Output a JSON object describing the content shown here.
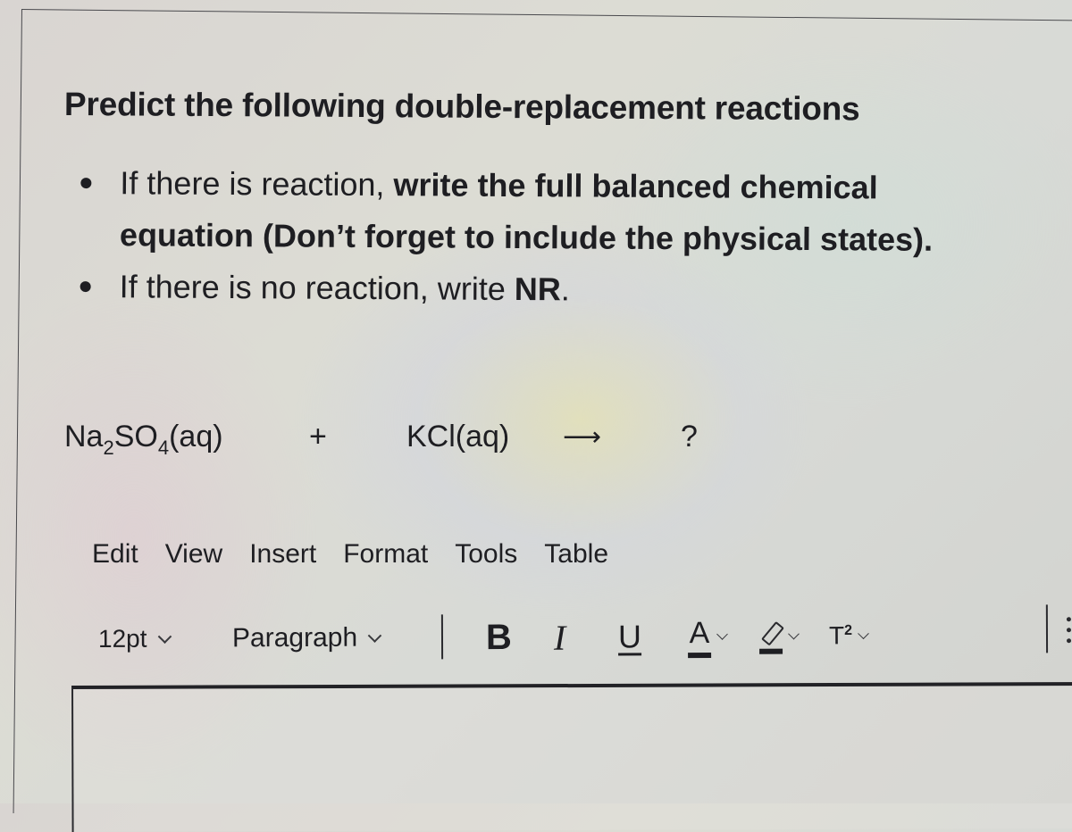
{
  "question": {
    "title": "Predict the following double-replacement reactions",
    "instructions": [
      {
        "normal": "If there is reaction, ",
        "bold": "write the full balanced chemical equation  (Don’t forget to include the physical states).",
        "line1_bold": "write the full balanced chemical",
        "line2_bold": "equation  (Don’t forget to include the physical states)."
      },
      {
        "normal": "If there is no reaction, write ",
        "bold": "NR",
        "trailing": "."
      }
    ]
  },
  "equation": {
    "reactant_1": {
      "prefix": "Na",
      "sub_1": "2",
      "middle": "SO",
      "sub_2": "4",
      "suffix": "(aq)"
    },
    "plus": "+",
    "reactant_2": "KCl(aq)",
    "arrow": "⟶",
    "product": "?"
  },
  "editor": {
    "menu": [
      "Edit",
      "View",
      "Insert",
      "Format",
      "Tools",
      "Table"
    ],
    "toolbar": {
      "font_size": "12pt",
      "block_format": "Paragraph",
      "bold": "B",
      "italic": "I",
      "underline": "U",
      "font_color": "A",
      "superscript_base": "T",
      "superscript_exp": "2"
    },
    "icons": {
      "font_color": "font-color-icon",
      "highlight": "highlight-pen-icon",
      "superscript": "superscript-icon",
      "more": "more-vertical-icon"
    },
    "content": ""
  }
}
